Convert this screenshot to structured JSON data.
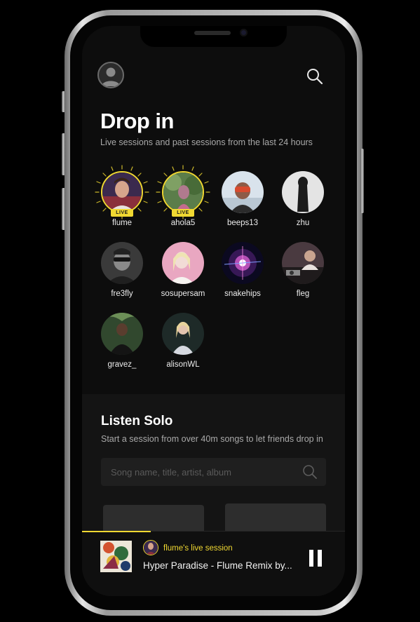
{
  "colors": {
    "accent": "#f0d832",
    "background": "#0d0d0d",
    "panel": "#141414"
  },
  "header": {
    "profile_icon": "user-avatar-icon",
    "search_icon": "search-icon"
  },
  "drop_in": {
    "title": "Drop in",
    "subtitle": "Live sessions and past sessions from the last 24 hours",
    "friends": [
      {
        "name": "flume",
        "live": true,
        "live_label": "LIVE"
      },
      {
        "name": "ahola5",
        "live": true,
        "live_label": "LIVE"
      },
      {
        "name": "beeps13",
        "live": false
      },
      {
        "name": "zhu",
        "live": false
      },
      {
        "name": "fre3fly",
        "live": false
      },
      {
        "name": "sosupersam",
        "live": false
      },
      {
        "name": "snakehips",
        "live": false
      },
      {
        "name": "fleg",
        "live": false
      },
      {
        "name": "gravez_",
        "live": false
      },
      {
        "name": "alisonWL",
        "live": false
      }
    ]
  },
  "listen_solo": {
    "title": "Listen Solo",
    "subtitle": "Start a session from over 40m songs to let friends drop in",
    "search_placeholder": "Song name, title, artist, album"
  },
  "now_playing": {
    "session_label": "flume's live session",
    "track": "Hyper Paradise - Flume Remix by...",
    "progress": 0.26,
    "control_icon": "pause-icon"
  }
}
